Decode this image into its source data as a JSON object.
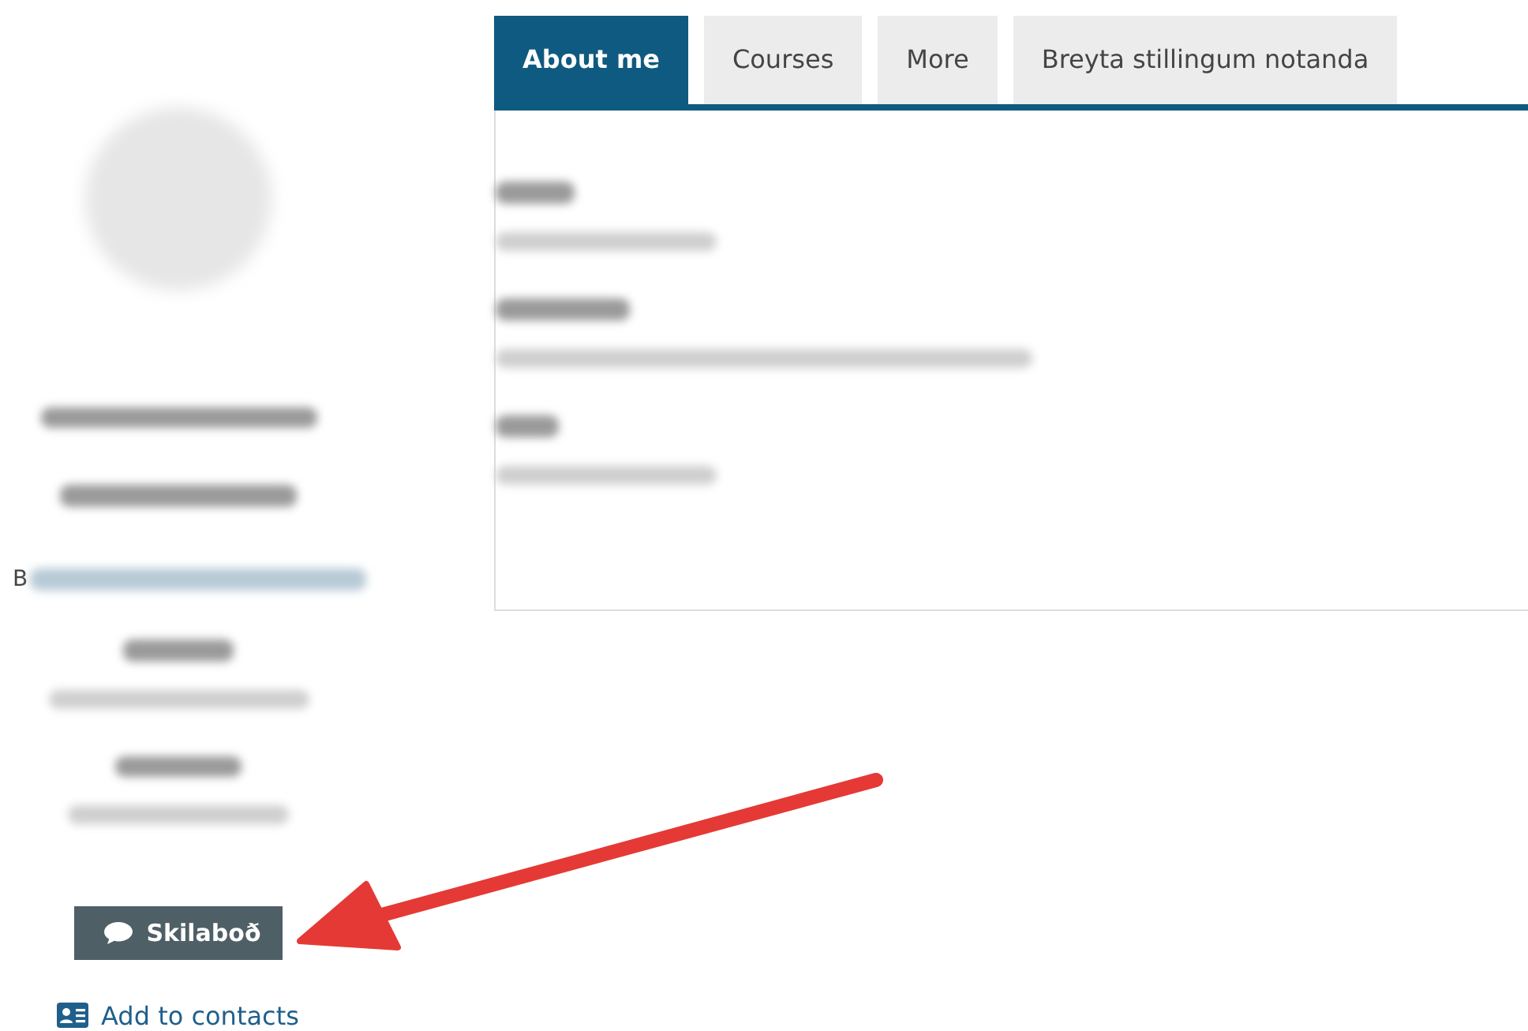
{
  "profile": {
    "link_fragment": "B",
    "message_button": {
      "label": "Skilaboð"
    },
    "contacts_link": {
      "label": "Add to contacts"
    }
  },
  "tabs": [
    {
      "label": "About me",
      "selected": true
    },
    {
      "label": "Courses",
      "selected": false
    },
    {
      "label": "More",
      "selected": false
    },
    {
      "label": "Breyta stillingum notanda",
      "selected": false
    }
  ]
}
